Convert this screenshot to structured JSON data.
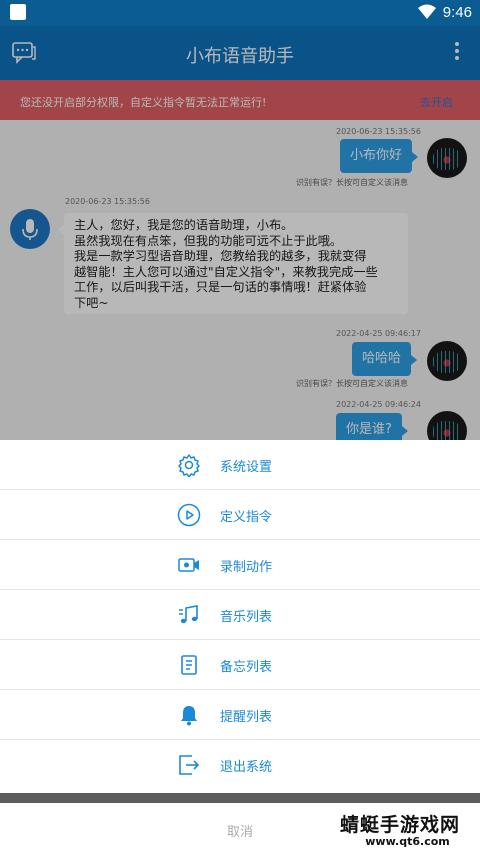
{
  "status_bar": {
    "time": "9:46"
  },
  "app_bar": {
    "title": "小布语音助手"
  },
  "warning": {
    "text": "您还没开启部分权限，自定义指令暂无法正常运行!",
    "action": "去开启"
  },
  "messages": [
    {
      "side": "right",
      "timestamp": "2020-06-23 15:35:56",
      "text": "小布你好",
      "hint": "识别有误？长按可自定义该消息"
    },
    {
      "side": "left",
      "timestamp": "2020-06-23 15:35:56",
      "lines": [
        "主人，您好，我是您的语音助理，小布。",
        "虽然我现在有点笨，但我的功能可远不止于此哦。",
        "我是一款学习型语音助理，您教给我的越多，我就变得",
        "越智能！主人您可以通过\"自定义指令\"，来教我完成一些",
        "工作，以后叫我干活，只是一句话的事情哦！赶紧体验",
        "下吧~"
      ]
    },
    {
      "side": "right",
      "timestamp": "2022-04-25 09:46:17",
      "text": "哈哈哈",
      "hint": "识别有误？长按可自定义该消息"
    },
    {
      "side": "right",
      "timestamp": "2022-04-25 09:46:24",
      "text": "你是谁?"
    }
  ],
  "menu": [
    {
      "label": "系统设置",
      "icon": "gear-icon"
    },
    {
      "label": "定义指令",
      "icon": "play-circle-icon"
    },
    {
      "label": "录制动作",
      "icon": "video-camera-icon"
    },
    {
      "label": "音乐列表",
      "icon": "music-note-icon"
    },
    {
      "label": "备忘列表",
      "icon": "notebook-icon"
    },
    {
      "label": "提醒列表",
      "icon": "bell-icon"
    },
    {
      "label": "退出系统",
      "icon": "exit-icon"
    }
  ],
  "cancel_label": "取消",
  "watermark": {
    "title": "蜻蜓手游戏网",
    "url": "www.qt6.com"
  },
  "colors": {
    "primary": "#0f74bd",
    "accent": "#1b8ad6",
    "warning": "#e06066",
    "bubble": "#2ea0e6"
  }
}
